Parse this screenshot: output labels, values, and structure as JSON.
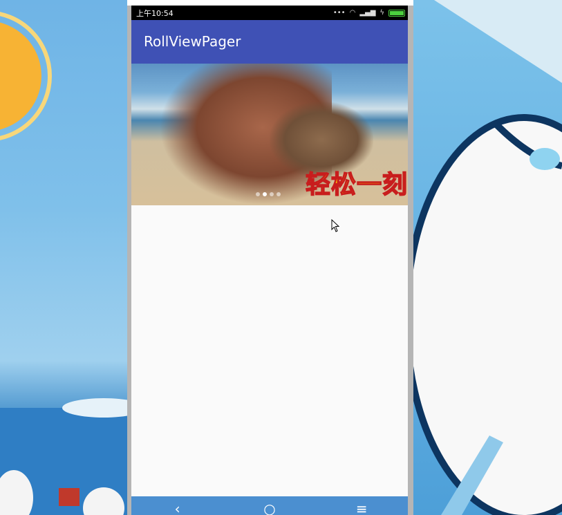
{
  "status_bar": {
    "time": "上午10:54",
    "icons": [
      "more-dots-icon",
      "wifi-icon",
      "signal-icon",
      "charging-icon",
      "battery-icon"
    ]
  },
  "app_bar": {
    "title": "RollViewPager",
    "color": "#3f51b5"
  },
  "banner": {
    "caption": "轻松一刻",
    "pager": {
      "total": 4,
      "active": 1
    }
  },
  "nav_bar": {
    "color": "#4b8fd0",
    "buttons": [
      {
        "icon": "back-icon",
        "glyph": "‹"
      },
      {
        "icon": "home-icon",
        "glyph": "○"
      },
      {
        "icon": "menu-icon",
        "glyph": "≡"
      }
    ]
  }
}
